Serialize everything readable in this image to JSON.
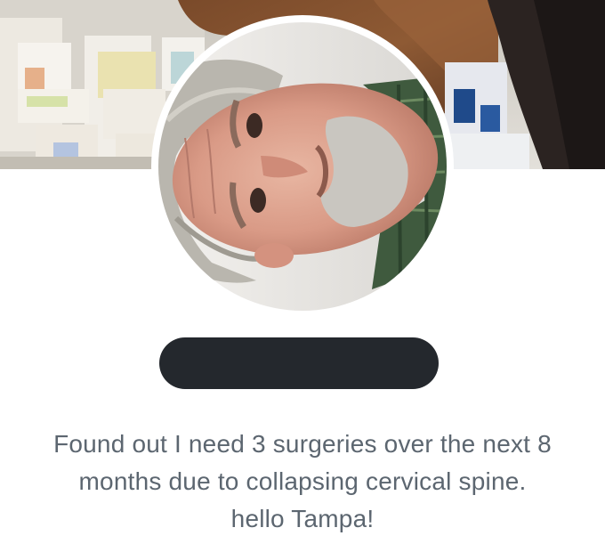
{
  "profile": {
    "name_redacted": true,
    "bio_lines": [
      "Found out I need 3 surgeries over the next 8",
      "months due to collapsing cervical  spine.",
      "hello Tampa!"
    ]
  },
  "colors": {
    "background": "#ffffff",
    "name_redaction": "#24282d",
    "bio_text": "#5c6670"
  }
}
